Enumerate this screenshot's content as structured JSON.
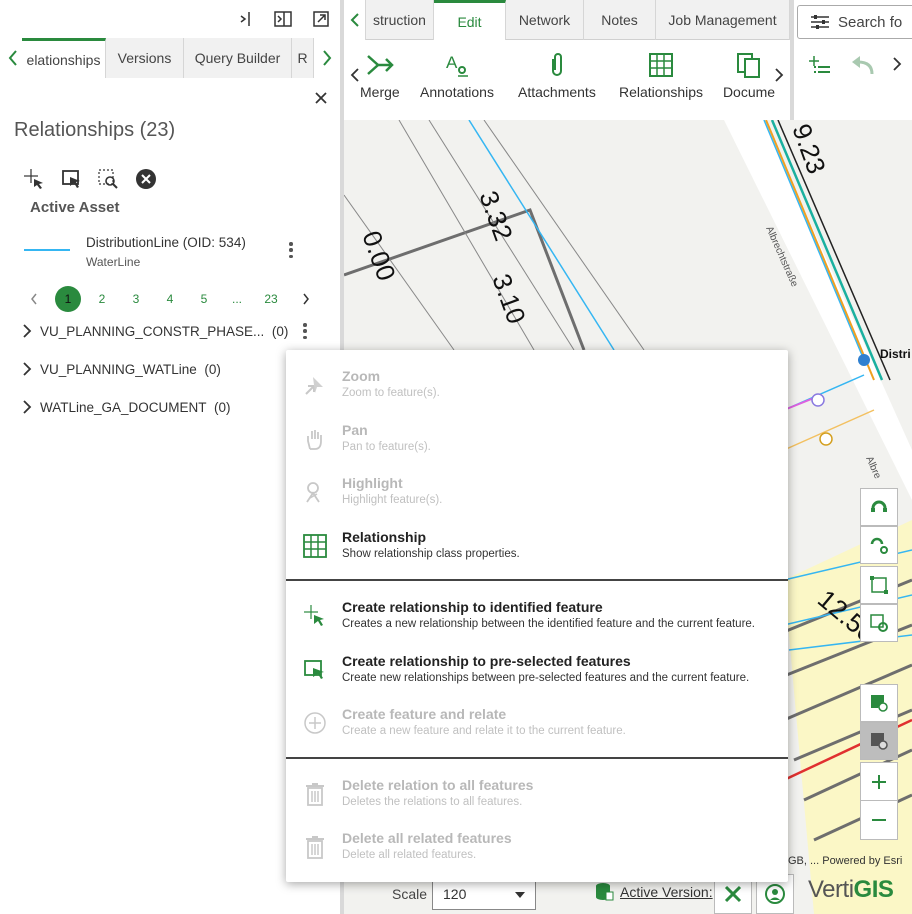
{
  "left_panel": {
    "tabs": [
      "elationships",
      "Versions",
      "Query Builder",
      "R"
    ],
    "title": "Relationships (23)",
    "active_asset_label": "Active Asset",
    "asset": {
      "name": "DistributionLine (OID: 534)",
      "layer": "WaterLine",
      "line_color": "#35b6f2"
    },
    "pager": {
      "pages": [
        "1",
        "2",
        "3",
        "4",
        "5",
        "...",
        "23"
      ],
      "current": "1"
    },
    "relationships": [
      {
        "name": "VU_PLANNING_CONSTR_PHASE...",
        "count": "(0)"
      },
      {
        "name": "VU_PLANNING_WATLine",
        "count": "(0)"
      },
      {
        "name": "WATLine_GA_DOCUMENT",
        "count": "(0)"
      }
    ]
  },
  "ribbon": {
    "tabs": [
      "struction",
      "Edit",
      "Network",
      "Notes",
      "Job Management"
    ],
    "active_tab": "Edit",
    "tools": [
      "Merge",
      "Annotations",
      "Attachments",
      "Relationships",
      "Docume"
    ]
  },
  "search": {
    "placeholder": "Search fo"
  },
  "map": {
    "labels": [
      "9.23",
      "3.32",
      "3.10",
      "0.00",
      "12.50",
      "Albrechtstraße",
      "Albre",
      "Distri"
    ],
    "attribution": "GB, ...   Powered by Esri"
  },
  "bottom": {
    "scale_label": "Scale",
    "scale_value": "120",
    "active_version_label": "Active Version:",
    "brand_a": "Verti",
    "brand_b": "GIS"
  },
  "context_menu": {
    "items": [
      {
        "title": "Zoom",
        "desc": "Zoom to feature(s).",
        "enabled": false
      },
      {
        "title": "Pan",
        "desc": "Pan to feature(s).",
        "enabled": false
      },
      {
        "title": "Highlight",
        "desc": "Highlight feature(s).",
        "enabled": false
      },
      {
        "title": "Relationship",
        "desc": "Show relationship class properties.",
        "enabled": true
      },
      {
        "title": "Create relationship to identified feature",
        "desc": "Creates a new relationship between the identified feature and the current feature.",
        "enabled": true
      },
      {
        "title": "Create relationship to pre-selected features",
        "desc": "Create new relationships between pre-selected features and the current feature.",
        "enabled": true
      },
      {
        "title": "Create feature and relate",
        "desc": "Create a new feature and relate it to the current feature.",
        "enabled": false
      },
      {
        "title": "Delete relation to all features",
        "desc": "Deletes the relations to all features.",
        "enabled": false
      },
      {
        "title": "Delete all related features",
        "desc": "Delete all related features.",
        "enabled": false
      }
    ]
  },
  "colors": {
    "accent": "#2a8a3e",
    "disabled": "#b8b8b8"
  }
}
